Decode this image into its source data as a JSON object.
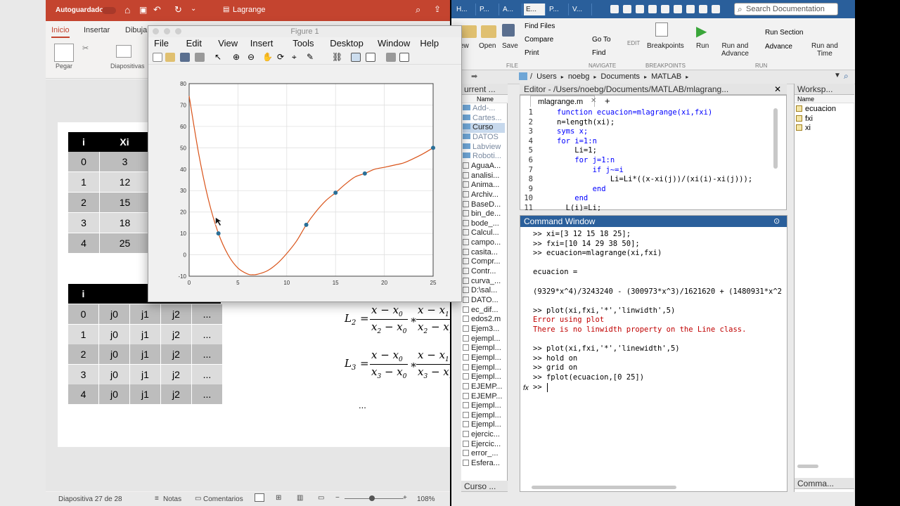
{
  "powerpoint": {
    "autosave_label": "Autoguardado",
    "autosave_state": "off",
    "doc_title": "Lagrange",
    "tabs": [
      "Inicio",
      "Insertar",
      "Dibuja"
    ],
    "ribbon": {
      "paste_label": "Pegar",
      "slides_label": "Diapositivas"
    },
    "table1": {
      "headers": [
        "i",
        "Xi"
      ],
      "rows": [
        [
          "0",
          "3"
        ],
        [
          "1",
          "12"
        ],
        [
          "2",
          "15"
        ],
        [
          "3",
          "18"
        ],
        [
          "4",
          "25"
        ]
      ]
    },
    "table2": {
      "headers": [
        "i",
        "",
        "",
        "",
        ""
      ],
      "rows": [
        [
          "0",
          "j0",
          "j1",
          "j2",
          "..."
        ],
        [
          "1",
          "j0",
          "j1",
          "j2",
          "..."
        ],
        [
          "2",
          "j0",
          "j1",
          "j2",
          "..."
        ],
        [
          "3",
          "j0",
          "j1",
          "j2",
          "..."
        ],
        [
          "4",
          "j0",
          "j1",
          "j2",
          "..."
        ]
      ]
    },
    "formula_l2_lhs": "L",
    "formula_l2_sub": "2",
    "formula_l3_lhs": "L",
    "formula_l3_sub": "3",
    "formula_ellipsis": "...",
    "status": {
      "slide": "Diapositiva 27 de 28",
      "notes": "Notas",
      "comments": "Comentarios",
      "zoom": "108%"
    }
  },
  "figure": {
    "title": "Figure 1",
    "menu": [
      "File",
      "Edit",
      "View",
      "Insert",
      "Tools",
      "Desktop",
      "Window",
      "Help"
    ]
  },
  "chart_data": {
    "type": "line",
    "title": "",
    "xlabel": "",
    "ylabel": "",
    "xlim": [
      0,
      25
    ],
    "ylim": [
      -10,
      80
    ],
    "xticks": [
      0,
      5,
      10,
      15,
      20,
      25
    ],
    "yticks": [
      -10,
      0,
      10,
      20,
      30,
      40,
      50,
      60,
      70,
      80
    ],
    "grid": true,
    "line_color": "#d95319",
    "marker_color": "#2a6f97",
    "curve_x": [
      0,
      1,
      2,
      3,
      4,
      5,
      6,
      6.5,
      7,
      8,
      9,
      10,
      11,
      12,
      13,
      14,
      15,
      16,
      17,
      18,
      19,
      20,
      21,
      22,
      23,
      24,
      25
    ],
    "curve_y": [
      74.2,
      46.7,
      25.3,
      10.0,
      -0.1,
      -6.2,
      -9.0,
      -9.3,
      -9.1,
      -7.5,
      -4.2,
      0.6,
      6.4,
      14.0,
      20.2,
      25.3,
      29.0,
      33.0,
      36.4,
      38.0,
      40.0,
      40.9,
      41.9,
      43.0,
      45.0,
      47.3,
      50.0
    ],
    "points_x": [
      3,
      12,
      15,
      18,
      25
    ],
    "points_y": [
      10,
      14,
      29,
      38,
      50
    ]
  },
  "matlab": {
    "tabs": [
      "H...",
      "P...",
      "A...",
      "E...",
      "P...",
      "V..."
    ],
    "search_placeholder": "Search Documentation",
    "toolstrip": {
      "find_files": "Find Files",
      "compare": "Compare",
      "print": "Print",
      "new": "ew",
      "open": "Open",
      "save": "Save",
      "go_to": "Go To",
      "find": "Find",
      "edit": "EDIT",
      "breakpoints": "Breakpoints",
      "run": "Run",
      "run_advance": "Run and\nAdvance",
      "run_section": "Run Section",
      "advance": "Advance",
      "run_time": "Run and\nTime",
      "section_file": "FILE",
      "section_navigate": "NAVIGATE",
      "section_breakpoints": "BREAKPOINTS",
      "section_run": "RUN"
    },
    "address": [
      "/",
      "Users",
      "noebg",
      "Documents",
      "MATLAB"
    ],
    "current_folder": {
      "title": "urrent ...",
      "name_header": "Name",
      "items": [
        "Add-...",
        "Cartes...",
        "Curso",
        "DATOS",
        "Labview",
        "Roboti...",
        "AguaA...",
        "analisi...",
        "Anima...",
        "Archiv...",
        "BaseD...",
        "bin_de...",
        "bode_...",
        "Calcul...",
        "campo...",
        "casita...",
        "Compr...",
        "Contr...",
        "curva_...",
        "D:\\sal...",
        "DATO...",
        "ec_dif...",
        "edos2.m",
        "Ejem3...",
        "ejempl...",
        "Ejempl...",
        "Ejempl...",
        "Ejempl...",
        "Ejempl...",
        "EJEMP...",
        "EJEMP...",
        "Ejempl...",
        "Ejempl...",
        "Ejempl...",
        "ejercic...",
        "Ejercic...",
        "error_...",
        "Esfera..."
      ],
      "footer": "Curso ..."
    },
    "editor": {
      "title": "Editor - /Users/noebg/Documents/MATLAB/mlagrang...",
      "tab": "mlagrange.m",
      "lines": [
        {
          "n": "1",
          "text": "function ecuacion=mlagrange(xi,fxi)"
        },
        {
          "n": "2",
          "text": "n=length(xi);"
        },
        {
          "n": "3",
          "text": "syms x;"
        },
        {
          "n": "4",
          "text": "for i=1:n"
        },
        {
          "n": "5",
          "text": "    Li=1;"
        },
        {
          "n": "6",
          "text": "    for j=1:n"
        },
        {
          "n": "7",
          "text": "        if j~=i"
        },
        {
          "n": "8",
          "text": "            Li=Li*((x-xi(j))/(xi(i)-xi(j)));"
        },
        {
          "n": "9",
          "text": "        end"
        },
        {
          "n": "10",
          "text": "    end"
        },
        {
          "n": "11",
          "text": "  L(i)=Li;"
        }
      ]
    },
    "command_window": {
      "title": "Command Window",
      "lines": [
        {
          "t": ">> xi=[3 12 15 18 25];",
          "c": "n"
        },
        {
          "t": ">> fxi=[10 14 29 38 50];",
          "c": "n"
        },
        {
          "t": ">> ecuacion=mlagrange(xi,fxi)",
          "c": "n"
        },
        {
          "t": "",
          "c": "n"
        },
        {
          "t": "ecuacion =",
          "c": "n"
        },
        {
          "t": "",
          "c": "n"
        },
        {
          "t": "(9329*x^4)/3243240 - (300973*x^3)/1621620 + (1480931*x^2",
          "c": "n"
        },
        {
          "t": "",
          "c": "n"
        },
        {
          "t": ">> plot(xi,fxi,'*','linwidth',5)",
          "c": "n"
        },
        {
          "t": "Error using plot",
          "c": "e"
        },
        {
          "t": "There is no linwidth property on the Line class.",
          "c": "e"
        },
        {
          "t": "",
          "c": "n"
        },
        {
          "t": ">> plot(xi,fxi,'*','linewidth',5)",
          "c": "n"
        },
        {
          "t": ">> hold on",
          "c": "n"
        },
        {
          "t": ">> grid on",
          "c": "n"
        },
        {
          "t": ">> fplot(ecuacion,[0 25])",
          "c": "n"
        }
      ],
      "prompt": ">>"
    },
    "workspace": {
      "title": "Worksp...",
      "name_header": "Name",
      "items": [
        "ecuacion",
        "fxi",
        "xi"
      ],
      "footer": "Comma..."
    }
  }
}
